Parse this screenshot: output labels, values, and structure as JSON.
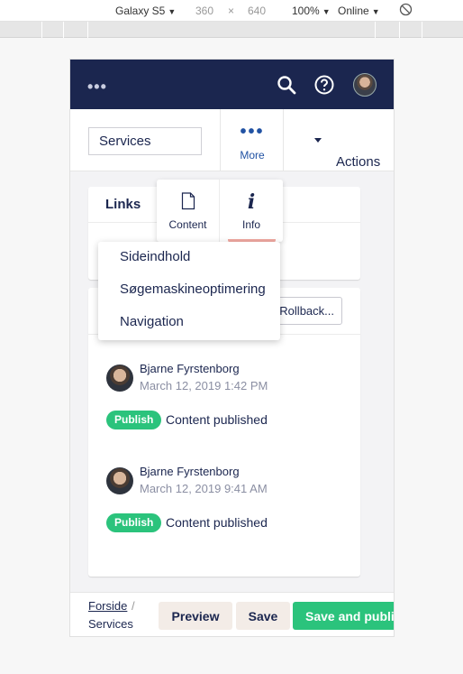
{
  "devtools": {
    "device": "Galaxy S5",
    "width": "360",
    "times": "×",
    "height": "640",
    "zoom": "100%",
    "network": "Online"
  },
  "header": {
    "menu_dots": "•••",
    "icons": [
      "search-icon",
      "help-icon",
      "user-avatar"
    ]
  },
  "topbar": {
    "name_value": "Services",
    "more_dots": "•••",
    "more_label": "More",
    "actions_label": "Actions"
  },
  "apps": {
    "items": [
      {
        "label": "Content",
        "icon": "document-icon"
      },
      {
        "label": "Info",
        "icon": "info-icon"
      }
    ]
  },
  "dropdown": {
    "items": [
      "Sideindhold",
      "Søgemaskineoptimering",
      "Navigation"
    ]
  },
  "links_box": {
    "title": "Links"
  },
  "history": {
    "rollback_label": "Rollback...",
    "entries": [
      {
        "user": "Bjarne Fyrstenborg",
        "date": "March 12, 2019 1:42 PM",
        "badge": "Publish",
        "message": "Content published"
      },
      {
        "user": "Bjarne Fyrstenborg",
        "date": "March 12, 2019 9:41 AM",
        "badge": "Publish",
        "message": "Content published"
      }
    ]
  },
  "footer": {
    "breadcrumb_root": "Forside",
    "breadcrumb_sep": "/",
    "breadcrumb_current": "Services",
    "preview_label": "Preview",
    "save_label": "Save",
    "publish_label": "Save and publish"
  },
  "colors": {
    "header_bg": "#1b264f",
    "accent_blue": "#2152a3",
    "publish_green": "#2bc37c",
    "secondary_button": "#f3ece7"
  }
}
